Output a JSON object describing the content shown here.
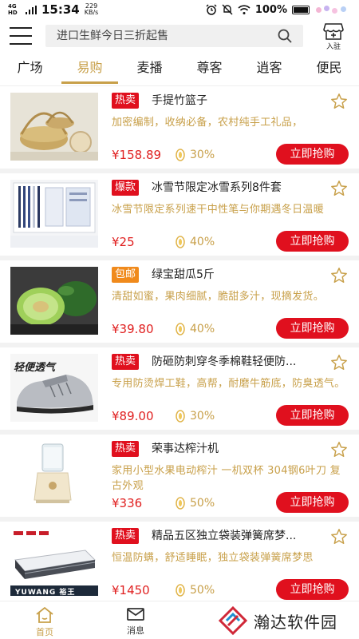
{
  "status_bar": {
    "network": "4G HD",
    "time": "15:34",
    "speed_value": "229",
    "speed_unit": "KB/s",
    "battery": "100%"
  },
  "header": {
    "search_placeholder": "进口生鲜今日三折起售",
    "join_label": "入驻"
  },
  "tabs": [
    {
      "label": "广场"
    },
    {
      "label": "易购",
      "active": true
    },
    {
      "label": "麦播"
    },
    {
      "label": "尊客"
    },
    {
      "label": "逍客"
    },
    {
      "label": "便民"
    }
  ],
  "products": [
    {
      "badge": "热卖",
      "badge_color": "#e0101e",
      "title": "手提竹篮子",
      "desc": "加密编制，收纳必备，农村纯手工礼品，",
      "price": "¥158.89",
      "rate": "30%",
      "button": "立即抢购",
      "image": "bamboo-basket"
    },
    {
      "badge": "爆款",
      "badge_color": "#e0101e",
      "title": "冰雪节限定冰雪系列8件套",
      "desc": "冰雪节限定系列速干中性笔与你期遇冬日温暖",
      "price": "¥25",
      "rate": "40%",
      "button": "立即抢购",
      "image": "pen-set"
    },
    {
      "badge": "包邮",
      "badge_color": "#f08a1c",
      "title": "绿宝甜瓜5斤",
      "desc": "清甜如蜜，果肉细腻，脆甜多汁，现摘发货。",
      "price": "¥39.80",
      "rate": "40%",
      "button": "立即抢购",
      "image": "melon"
    },
    {
      "badge": "热卖",
      "badge_color": "#e0101e",
      "title": "防砸防刺穿冬季棉鞋轻便防...",
      "desc": "专用防烫焊工鞋，高帮，耐磨牛筋底，防臭透气。",
      "price": "¥89.00",
      "rate": "30%",
      "button": "立即抢购",
      "image": "safety-shoe",
      "image_text": "轻便透气"
    },
    {
      "badge": "热卖",
      "badge_color": "#e0101e",
      "title": "荣事达榨汁机",
      "desc": "家用小型水果电动榨汁 一机双杯 304钢6叶刀 复古外观",
      "price": "¥336",
      "rate": "50%",
      "button": "立即抢购",
      "image": "juicer"
    },
    {
      "badge": "热卖",
      "badge_color": "#e0101e",
      "title": "精品五区独立袋装弹簧席梦...",
      "desc": "恒温防螨，舒适睡眠，独立袋装弹簧席梦思",
      "price": "¥1450",
      "rate": "50%",
      "button": "立即抢购",
      "image": "mattress",
      "image_text": "YUWANG 裕王"
    }
  ],
  "bottom_nav": {
    "home_label": "首页",
    "message_label": "消息",
    "accent": "#c8a04a"
  },
  "watermark": "瀚达软件园",
  "colors": {
    "accent": "#c8a04a",
    "red": "#e0101e"
  }
}
